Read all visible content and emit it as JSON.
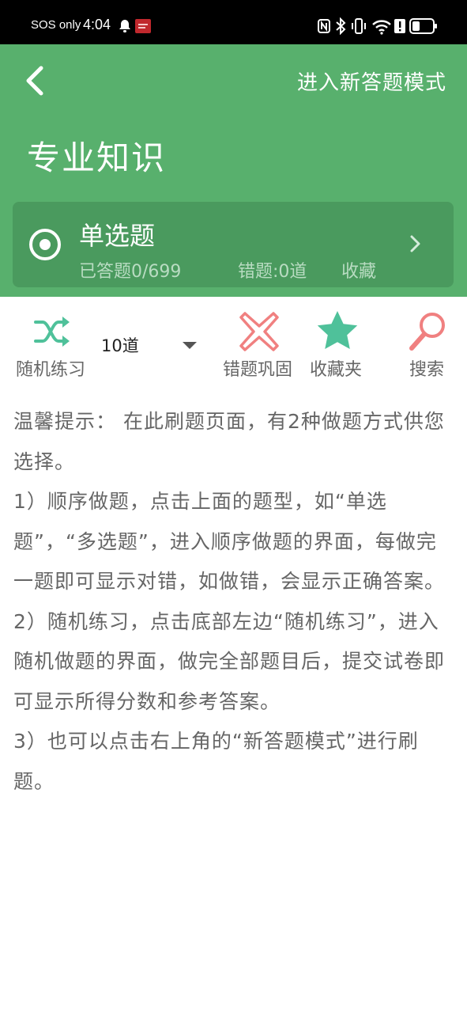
{
  "status_bar": {
    "carrier": "SOS only",
    "time": "4:04"
  },
  "header": {
    "new_mode_label": "进入新答题模式",
    "title": "专业知识"
  },
  "question_type": {
    "name": "单选题",
    "answered": "已答题0/699",
    "wrong": "错题:0道",
    "favorite": "收藏"
  },
  "toolbar": {
    "random_label": "随机练习",
    "count_value": "10道",
    "wrong_label": "错题巩固",
    "favorites_label": "收藏夹",
    "search_label": "搜索"
  },
  "tips": {
    "intro": "温馨提示： 在此刷题页面，有2种做题方式供您选择。",
    "item1": " 1）顺序做题，点击上面的题型，如“单选题”，“多选题”，进入顺序做题的界面，每做完一题即可显示对错，如做错，会显示正确答案。",
    "item2": " 2）随机练习，点击底部左边“随机练习”，进入随机做题的界面，做完全部题目后，提交试卷即可显示所得分数和参考答案。",
    "item3": " 3）也可以点击右上角的“新答题模式”进行刷题。"
  },
  "colors": {
    "header_green": "#58b06d",
    "card_green": "#4a9a5e",
    "teal": "#4fc19a",
    "red": "#f08080"
  }
}
